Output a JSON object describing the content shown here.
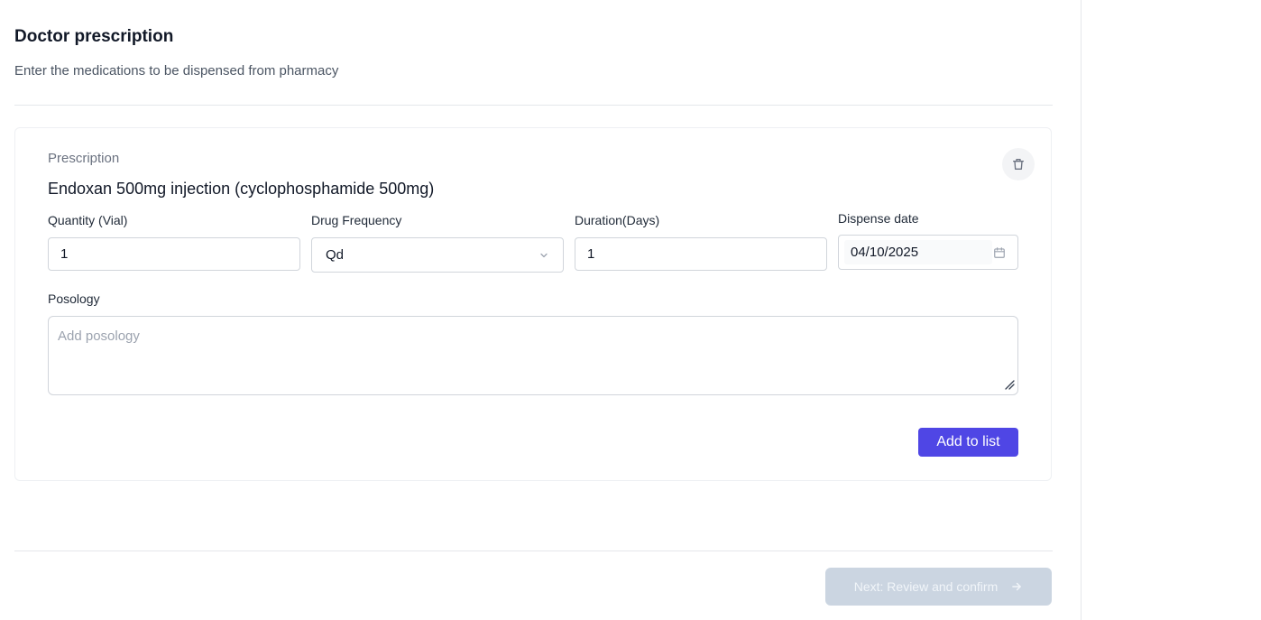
{
  "header": {
    "title": "Doctor prescription",
    "subtitle": "Enter the medications to be dispensed from pharmacy"
  },
  "prescription": {
    "label": "Prescription",
    "drug_name": "Endoxan 500mg injection (cyclophosphamide 500mg)",
    "delete_icon": "trash-icon",
    "fields": {
      "quantity": {
        "label": "Quantity (Vial)",
        "value": "1"
      },
      "frequency": {
        "label": "Drug Frequency",
        "value": "Qd"
      },
      "duration": {
        "label": "Duration(Days)",
        "value": "1"
      },
      "dispense_date": {
        "label": "Dispense date",
        "value": "04/10/2025"
      }
    },
    "posology": {
      "label": "Posology",
      "placeholder": "Add posology",
      "value": ""
    },
    "add_button_label": "Add to list"
  },
  "footer": {
    "next_label": "Next: Review and confirm",
    "next_icon": "arrow-right-icon"
  },
  "colors": {
    "primary": "#4f46e5",
    "disabled": "#cbd5e1",
    "border": "#d1d5db"
  }
}
